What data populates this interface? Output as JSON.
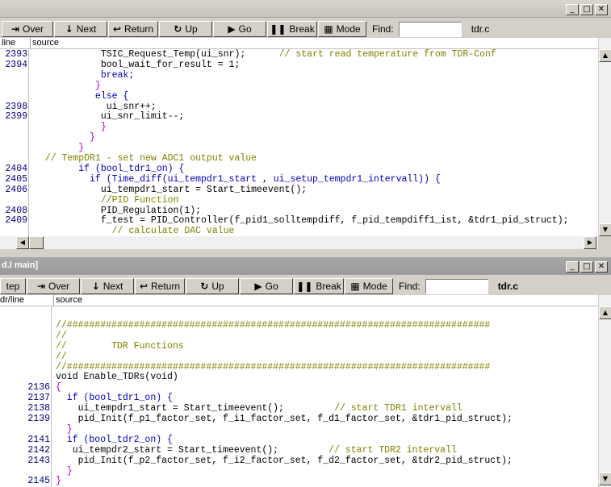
{
  "top": {
    "toolbar": [
      {
        "label": "Over",
        "icon": "step-over-icon"
      },
      {
        "label": "Next",
        "icon": "next-icon"
      },
      {
        "label": "Return",
        "icon": "return-icon"
      },
      {
        "label": "Up",
        "icon": "up-icon"
      },
      {
        "label": "Go",
        "icon": "go-icon"
      },
      {
        "label": "Break",
        "icon": "break-icon"
      },
      {
        "label": "Mode",
        "icon": "mode-icon"
      }
    ],
    "find_label": "Find:",
    "find_value": "",
    "filename": "tdr.c",
    "col_line": "line",
    "col_source": "source",
    "lines": [
      {
        "no": "2393",
        "code": [
          [
            "            TSIC_Request_Temp(ui_snr);      ",
            "d"
          ],
          [
            "// start read temperature from TDR-Conf",
            "c"
          ]
        ]
      },
      {
        "no": "2394",
        "code": [
          [
            "            bool_wait_for_result = 1;",
            "d"
          ]
        ]
      },
      {
        "no": "",
        "code": [
          [
            "            break;",
            "k"
          ]
        ]
      },
      {
        "no": "",
        "code": [
          [
            "           }",
            "b"
          ]
        ]
      },
      {
        "no": "",
        "code": [
          [
            "           else {",
            "k"
          ]
        ]
      },
      {
        "no": "2398",
        "code": [
          [
            "             ui_snr++;",
            "d"
          ]
        ]
      },
      {
        "no": "2399",
        "code": [
          [
            "            ui_snr_limit--;",
            "d"
          ]
        ]
      },
      {
        "no": "",
        "code": [
          [
            "            }",
            "b"
          ]
        ]
      },
      {
        "no": "",
        "code": [
          [
            "          }",
            "b"
          ]
        ]
      },
      {
        "no": "",
        "code": [
          [
            "        }",
            "b"
          ]
        ]
      },
      {
        "no": "",
        "code": [
          [
            "  // TempDR1 - set new ADC1 output value",
            "c"
          ]
        ]
      },
      {
        "no": "2404",
        "code": [
          [
            "        if (bool_tdr1_on) {",
            "k"
          ]
        ]
      },
      {
        "no": "2405",
        "code": [
          [
            "          if (Time_diff(ui_tempdr1_start , ui_setup_tempdr1_intervall)) {",
            "k"
          ]
        ]
      },
      {
        "no": "2406",
        "code": [
          [
            "            ui_tempdr1_start = Start_timeevent();",
            "d"
          ]
        ]
      },
      {
        "no": "",
        "code": [
          [
            "            //PID Function",
            "c"
          ]
        ]
      },
      {
        "no": "2408",
        "code": [
          [
            "            PID_Regulation(1);",
            "d"
          ]
        ]
      },
      {
        "no": "2409",
        "code": [
          [
            "            f_test = PID_Controller(f_pid1_solltempdiff, f_pid_tempdiff1_ist, &tdr1_pid_struct);",
            "d"
          ]
        ]
      },
      {
        "no": "",
        "code": [
          [
            "              // calculate DAC value",
            "c"
          ]
        ]
      }
    ]
  },
  "bottom": {
    "title": "d.l main]",
    "toolbar": [
      {
        "label": "tep",
        "icon": ""
      },
      {
        "label": "Over",
        "icon": "step-over-icon"
      },
      {
        "label": "Next",
        "icon": "next-icon"
      },
      {
        "label": "Return",
        "icon": "return-icon"
      },
      {
        "label": "Up",
        "icon": "up-icon"
      },
      {
        "label": "Go",
        "icon": "go-icon"
      },
      {
        "label": "Break",
        "icon": "break-icon"
      },
      {
        "label": "Mode",
        "icon": "mode-icon"
      }
    ],
    "find_label": "Find:",
    "find_value": "",
    "filename": "tdr.c",
    "col_line": "dr/line",
    "col_source": "source",
    "lines": [
      {
        "no": "",
        "code": [
          [
            "",
            "d"
          ]
        ]
      },
      {
        "no": "",
        "code": [
          [
            "//############################################################################",
            "c"
          ]
        ]
      },
      {
        "no": "",
        "code": [
          [
            "//",
            "c"
          ]
        ]
      },
      {
        "no": "",
        "code": [
          [
            "//        TDR Functions",
            "c"
          ]
        ]
      },
      {
        "no": "",
        "code": [
          [
            "//",
            "c"
          ]
        ]
      },
      {
        "no": "",
        "code": [
          [
            "//############################################################################",
            "c"
          ]
        ]
      },
      {
        "no": "",
        "code": [
          [
            "void Enable_TDRs(void)",
            "d"
          ]
        ]
      },
      {
        "no": "2136",
        "code": [
          [
            "{",
            "b"
          ]
        ]
      },
      {
        "no": "2137",
        "code": [
          [
            "  if (bool_tdr1_on) {",
            "k"
          ]
        ]
      },
      {
        "no": "2138",
        "code": [
          [
            "    ui_tempdr1_start = Start_timeevent();         ",
            "d"
          ],
          [
            "// start TDR1 intervall",
            "c"
          ]
        ]
      },
      {
        "no": "2139",
        "code": [
          [
            "    pid_Init(f_p1_factor_set, f_i1_factor_set, f_d1_factor_set, &tdr1_pid_struct);",
            "d"
          ]
        ]
      },
      {
        "no": "",
        "code": [
          [
            "  }",
            "b"
          ]
        ]
      },
      {
        "no": "2141",
        "code": [
          [
            "  if (bool_tdr2_on) {",
            "k"
          ]
        ]
      },
      {
        "no": "2142",
        "code": [
          [
            "   ui_tempdr2_start = Start_timeevent();         ",
            "d"
          ],
          [
            "// start TDR2 intervall",
            "c"
          ]
        ]
      },
      {
        "no": "2143",
        "code": [
          [
            "    pid_Init(f_p2_factor_set, f_i2_factor_set, f_d2_factor_set, &tdr2_pid_struct);",
            "d"
          ]
        ]
      },
      {
        "no": "",
        "code": [
          [
            "  }",
            "b"
          ]
        ]
      },
      {
        "no": "2145",
        "code": [
          [
            "}",
            "b"
          ]
        ]
      }
    ]
  }
}
